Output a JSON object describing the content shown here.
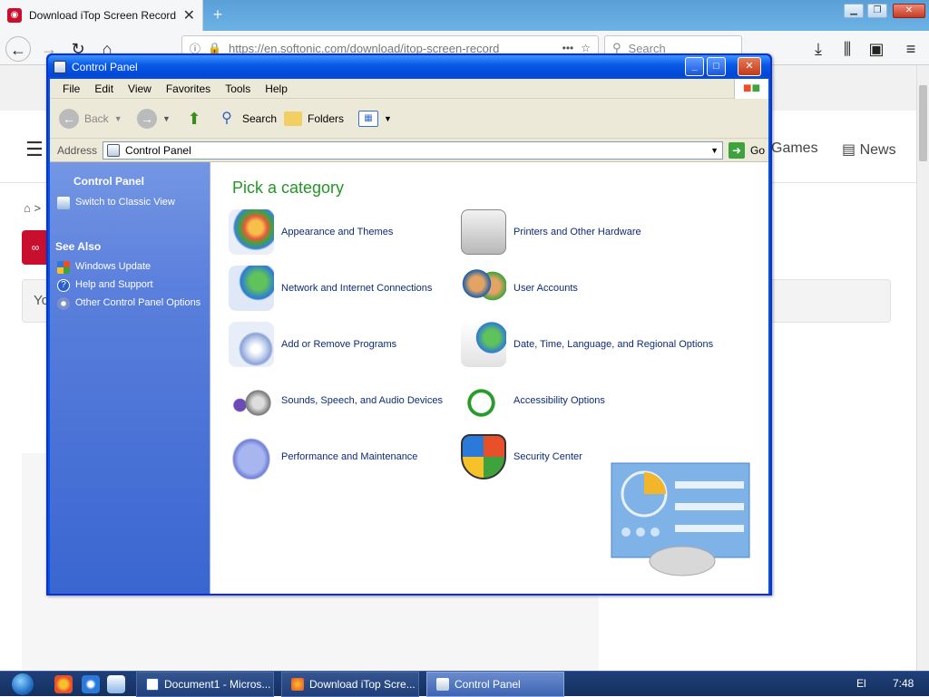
{
  "browser": {
    "tab_title": "Download iTop Screen Recorder",
    "url": "https://en.softonic.com/download/itop-screen-record",
    "search_placeholder": "Search"
  },
  "page": {
    "nav_games": "Games",
    "nav_news": "News",
    "box_text": "Yo"
  },
  "cp": {
    "title": "Control Panel",
    "menu": [
      "File",
      "Edit",
      "View",
      "Favorites",
      "Tools",
      "Help"
    ],
    "toolbar": {
      "back": "Back",
      "search": "Search",
      "folders": "Folders"
    },
    "address_label": "Address",
    "address_value": "Control Panel",
    "go": "Go",
    "side": {
      "header": "Control Panel",
      "switch": "Switch to Classic View",
      "see_also": "See Also",
      "links": [
        "Windows Update",
        "Help and Support",
        "Other Control Panel Options"
      ]
    },
    "pick": "Pick a category",
    "categories": [
      "Appearance and Themes",
      "Printers and Other Hardware",
      "Network and Internet Connections",
      "User Accounts",
      "Add or Remove Programs",
      "Date, Time, Language, and Regional Options",
      "Sounds, Speech, and Audio Devices",
      "Accessibility Options",
      "Performance and Maintenance",
      "Security Center"
    ]
  },
  "taskbar": {
    "tasks": [
      "Document1 - Micros...",
      "Download iTop Scre...",
      "Control Panel"
    ],
    "lang": "El",
    "clock": "7:48"
  },
  "colors": {
    "xp_blue": "#0054e3",
    "category_green": "#249624"
  }
}
